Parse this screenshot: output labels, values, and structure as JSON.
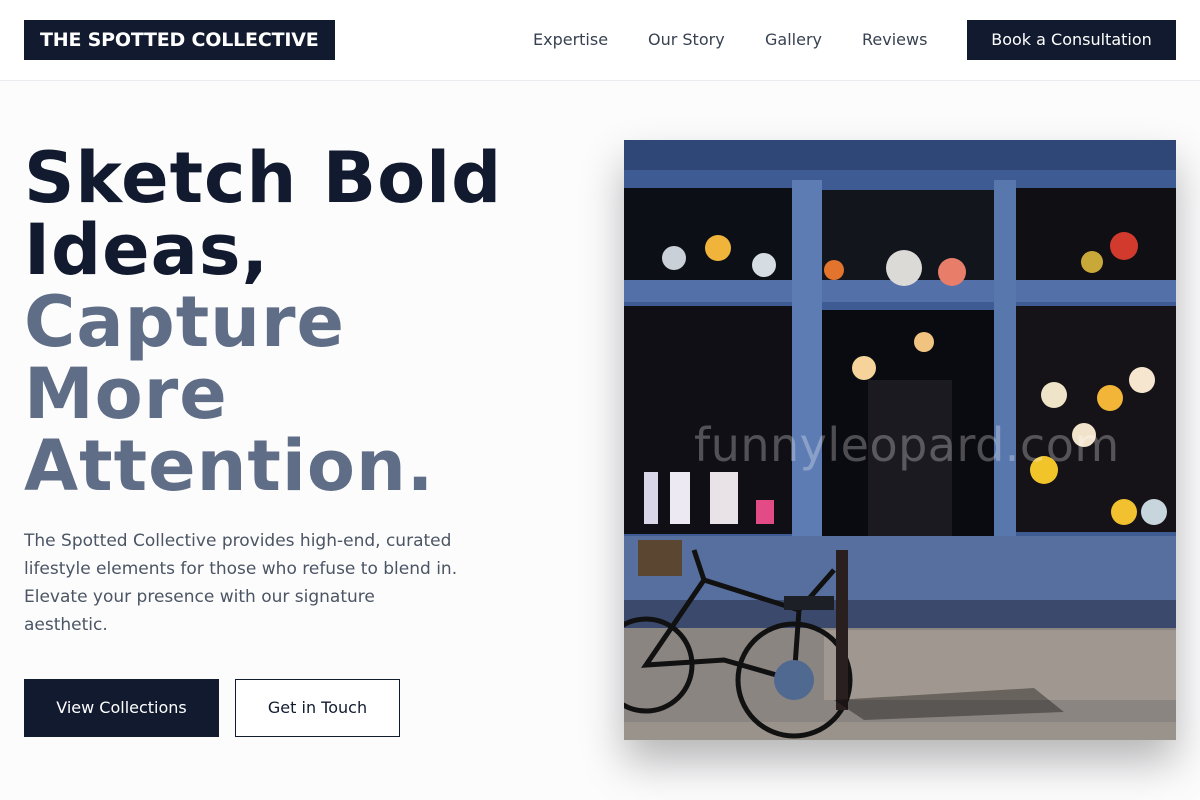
{
  "header": {
    "logo": "THE SPOTTED COLLECTIVE",
    "nav": [
      {
        "label": "Expertise"
      },
      {
        "label": "Our Story"
      },
      {
        "label": "Gallery"
      },
      {
        "label": "Reviews"
      }
    ],
    "cta_label": "Book a Consultation"
  },
  "hero": {
    "headline_dark_1": "Sketch Bold",
    "headline_dark_2": "Ideas,",
    "headline_muted_1": "Capture",
    "headline_muted_2": "More",
    "headline_muted_3": "Attention.",
    "description": "The Spotted Collective provides high-end, curated lifestyle elements for those who refuse to blend in. Elevate your presence with our signature aesthetic.",
    "primary_button": "View Collections",
    "secondary_button": "Get in Touch",
    "image_watermark": "funnyleopard.com"
  },
  "colors": {
    "navy": "#111a2e",
    "muted_headline": "#5f6d86",
    "body_text": "#4b5563",
    "shopfront_blue": "#3e5a91"
  }
}
